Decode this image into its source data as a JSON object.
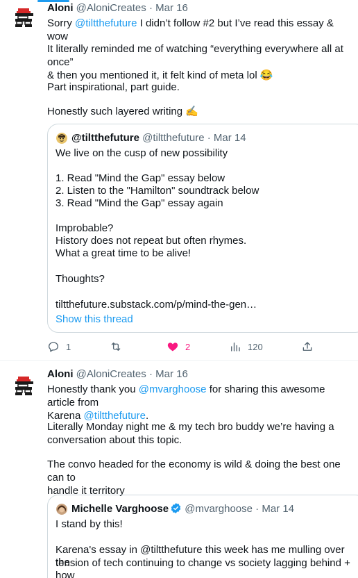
{
  "tweets": [
    {
      "author_name": "Aloni",
      "author_handle": "@AloniCreates",
      "date": "Mar 16",
      "body": {
        "p1_prefix": "Sorry ",
        "p1_mention": "@tiltthefuture",
        "p1_suffix": " I didn’t follow #2 but I’ve read this essay & wow",
        "p2_line1": "It literally reminded me of watching “everything everywhere all at once”",
        "p2_line2": "& then you mentioned it, it felt kind of meta lol 😂",
        "p3": "Part inspirational, part guide.",
        "p4": "Honestly such layered writing ✍️"
      },
      "quote": {
        "author_name": "@tiltthefuture",
        "author_handle": "@tiltthefuture",
        "date": "Mar 14",
        "lines": {
          "l1": "We live on the cusp of new possibility",
          "l2": "1. Read \"Mind the Gap\" essay below",
          "l3": "2. Listen to the \"Hamilton\" soundtrack below",
          "l4": "3. Read \"Mind the Gap\" essay again",
          "l5": "Improbable?",
          "l6": "History does not repeat but often rhymes.",
          "l7": "What a great time to be alive!",
          "l8": "Thoughts?",
          "l9": "tiltthefuture.substack.com/p/mind-the-gen…"
        },
        "show_thread": "Show this thread"
      },
      "actions": {
        "replies": "1",
        "retweets": "",
        "likes": "2",
        "views": "120"
      }
    },
    {
      "author_name": "Aloni",
      "author_handle": "@AloniCreates",
      "date": "Mar 16",
      "body": {
        "p1_prefix": "Honestly thank you ",
        "p1_mention": "@mvarghoose",
        "p1_mid": " for sharing this awesome article from",
        "p1_line2_prefix": "Karena ",
        "p1_mention2": "@tiltthefuture",
        "p1_end": ".",
        "p2_line1": "Literally Monday night me & my tech bro buddy we’re having a",
        "p2_line2": "conversation about this topic.",
        "p3_line1": "The convo headed for the economy is wild & doing the best one can to",
        "p3_line2": "handle it territory"
      },
      "quote": {
        "author_name": "Michelle Varghoose",
        "author_handle": "@mvarghoose",
        "date": "Mar 14",
        "lines": {
          "l1": "I stand by this!",
          "l2": "Karena's essay in @tiltthefuture this week has me mulling over the",
          "l3": "tension of tech continuing to change vs society lagging behind + how"
        }
      }
    }
  ],
  "colors": {
    "accent": "#1d9bf0",
    "like": "#f91880",
    "secondary_text": "#536471"
  }
}
